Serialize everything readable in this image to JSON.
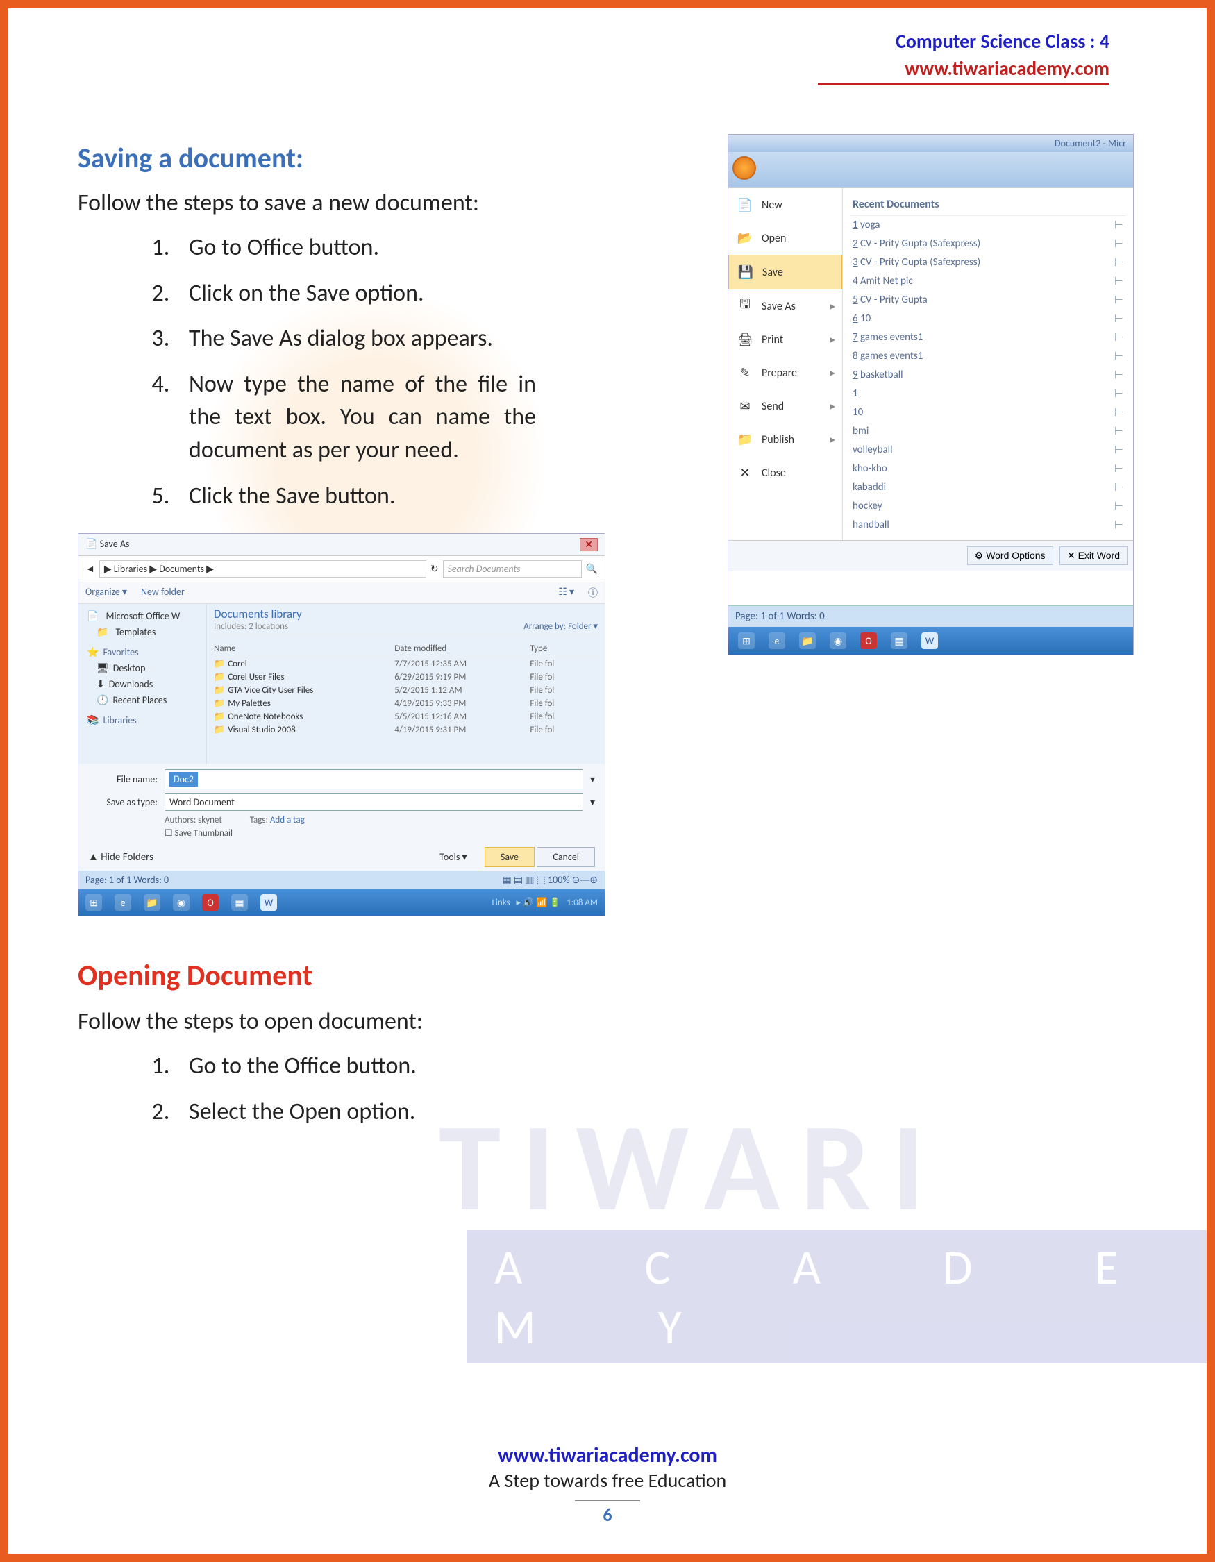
{
  "header": {
    "line1": "Computer Science Class : 4",
    "line2": "www.tiwariacademy.com"
  },
  "section1": {
    "title": "Saving a document:",
    "intro": "Follow the steps to save a new document:",
    "steps": [
      "Go to Office button.",
      "Click on the Save option.",
      "The Save As dialog box appears.",
      "Now type the name of the file in the text box. You can name the document as per your need.",
      "Click the Save button."
    ]
  },
  "office_menu": {
    "window_title": "Document2 - Micr",
    "left": [
      {
        "label": "New"
      },
      {
        "label": "Open"
      },
      {
        "label": "Save",
        "highlight": true
      },
      {
        "label": "Save As",
        "arrow": true
      },
      {
        "label": "Print",
        "arrow": true
      },
      {
        "label": "Prepare",
        "arrow": true
      },
      {
        "label": "Send",
        "arrow": true
      },
      {
        "label": "Publish",
        "arrow": true
      },
      {
        "label": "Close"
      }
    ],
    "recent_title": "Recent Documents",
    "recent": [
      "yoga",
      "CV - Prity Gupta (Safexpress)",
      "CV - Prity Gupta (Safexpress)",
      "Amit Net pic",
      "CV - Prity Gupta",
      "10",
      "games events1",
      "games events1",
      "basketball",
      "1",
      "10",
      "bmi",
      "volleyball",
      "kho-kho",
      "kabaddi",
      "hockey",
      "handball"
    ],
    "footer_buttons": [
      "Word Options",
      "Exit Word"
    ],
    "status": "Page: 1 of 1    Words: 0"
  },
  "saveas": {
    "title": "Save As",
    "path": "▶ Libraries ▶ Documents ▶",
    "search_placeholder": "Search Documents",
    "toolbar": [
      "Organize ▾",
      "New folder"
    ],
    "nav_left": {
      "top": [
        "Microsoft Office W",
        "Templates"
      ],
      "favorites_label": "Favorites",
      "favorites": [
        "Desktop",
        "Downloads",
        "Recent Places"
      ],
      "libraries_label": "Libraries"
    },
    "lib_title": "Documents library",
    "lib_sub": "Includes: 2 locations",
    "arrange": "Arrange by:  Folder ▾",
    "columns": [
      "Name",
      "Date modified",
      "Type"
    ],
    "rows": [
      {
        "name": "Corel",
        "date": "7/7/2015 12:35 AM",
        "type": "File fol"
      },
      {
        "name": "Corel User Files",
        "date": "6/29/2015 9:19 PM",
        "type": "File fol"
      },
      {
        "name": "GTA Vice City User Files",
        "date": "5/2/2015 1:12 AM",
        "type": "File fol"
      },
      {
        "name": "My Palettes",
        "date": "4/19/2015 9:33 PM",
        "type": "File fol"
      },
      {
        "name": "OneNote Notebooks",
        "date": "5/5/2015 12:16 AM",
        "type": "File fol"
      },
      {
        "name": "Visual Studio 2008",
        "date": "4/19/2015 9:31 PM",
        "type": "File fol"
      }
    ],
    "fields": {
      "filename_label": "File name:",
      "filename_value": "Doc2",
      "savetype_label": "Save as type:",
      "savetype_value": "Word Document",
      "authors_label": "Authors:",
      "authors_value": "skynet",
      "tags_label": "Tags:",
      "tags_value": "Add a tag",
      "thumb": "Save Thumbnail"
    },
    "hide_folders": "Hide Folders",
    "tools": "Tools ▾",
    "save_btn": "Save",
    "cancel_btn": "Cancel",
    "status": {
      "left": "Page: 1 of 1   Words: 0",
      "right": "100%"
    },
    "taskbar_time": "1:08 AM",
    "taskbar_links": "Links"
  },
  "section2": {
    "title": "Opening Document",
    "intro": "Follow the steps to open document:",
    "steps": [
      "Go to the Office button.",
      "Select the Open option."
    ]
  },
  "footer": {
    "link": "www.tiwariacademy.com",
    "tag": "A Step towards free Education",
    "page": "6"
  },
  "watermark": {
    "brand": "TIWARI",
    "sub": "A  C  A  D  E  M  Y"
  }
}
